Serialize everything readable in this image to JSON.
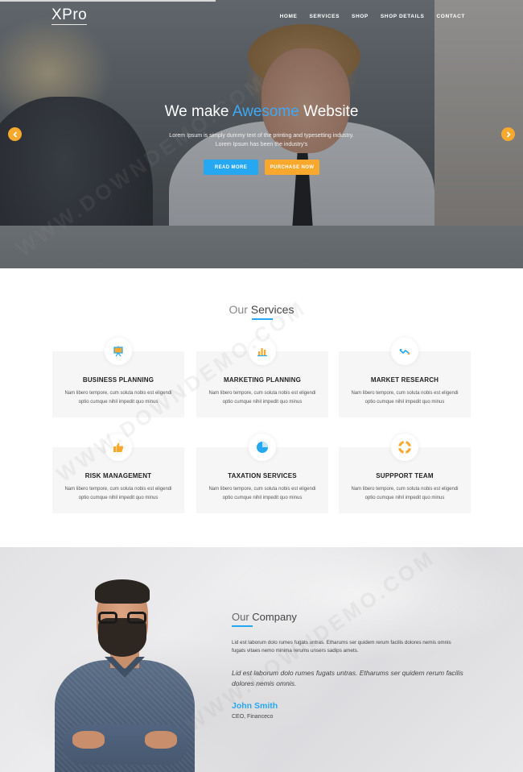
{
  "header": {
    "logo": "XPro",
    "nav": [
      "HOME",
      "SERVICES",
      "SHOP",
      "SHOP DETAILS",
      "CONTACT"
    ]
  },
  "hero": {
    "title_pre": "We make",
    "title_accent": "Awesome",
    "title_post": "Website",
    "text": "Lorem Ipsum is simply dummy text of the printing and typesetting industry. Lorem Ipsum has been the industry's",
    "btn_primary": "READ MORE",
    "btn_secondary": "PURCHASE NOW",
    "prev_icon": "chevron-left-icon",
    "next_icon": "chevron-right-icon"
  },
  "services": {
    "title_light": "Our",
    "title_strong": "Services",
    "items": [
      {
        "title": "BUSINESS PLANNING",
        "text": "Nam libero tempore, cum soluta nobis est eligendi optio cumque nihil impedit quo minus",
        "icon": "presentation-board-icon"
      },
      {
        "title": "MARKETING PLANNING",
        "text": "Nam libero tempore, cum soluta nobis est eligendi optio cumque nihil impedit quo minus",
        "icon": "bar-chart-icon"
      },
      {
        "title": "MARKET RESEARCH",
        "text": "Nam libero tempore, cum soluta nobis est eligendi optio cumque nihil impedit quo minus",
        "icon": "trend-chart-icon"
      },
      {
        "title": "RISK MANAGEMENT",
        "text": "Nam libero tempore, cum soluta nobis est eligendi optio cumque nihil impedit quo minus",
        "icon": "thumbs-up-icon"
      },
      {
        "title": "TAXATION SERVICES",
        "text": "Nam libero tempore, cum soluta nobis est eligendi optio cumque nihil impedit quo minus",
        "icon": "pie-chart-icon"
      },
      {
        "title": "SUPPPORT TEAM",
        "text": "Nam libero tempore, cum soluta nobis est eligendi optio cumque nihil impedit quo minus",
        "icon": "lifebuoy-icon"
      }
    ]
  },
  "company": {
    "title_light": "Our",
    "title_strong": "Company",
    "text": "Lid est laborum dolo rumes fugats untras. Etharums ser quidem rerum facilis dolores nemis omnis fugats vitaes nemo minima rerums unsers sadips amets.",
    "quote": "Lid est laborum dolo rumes fugats untras. Etharums ser quidem rerum facilis dolores nemis omnis.",
    "name": "John Smith",
    "role": "CEO, Financeco"
  },
  "watermark": "WWW.DOWNDEMO.COM",
  "colors": {
    "accent_blue": "#25a7f1",
    "accent_orange": "#f8a92d"
  }
}
